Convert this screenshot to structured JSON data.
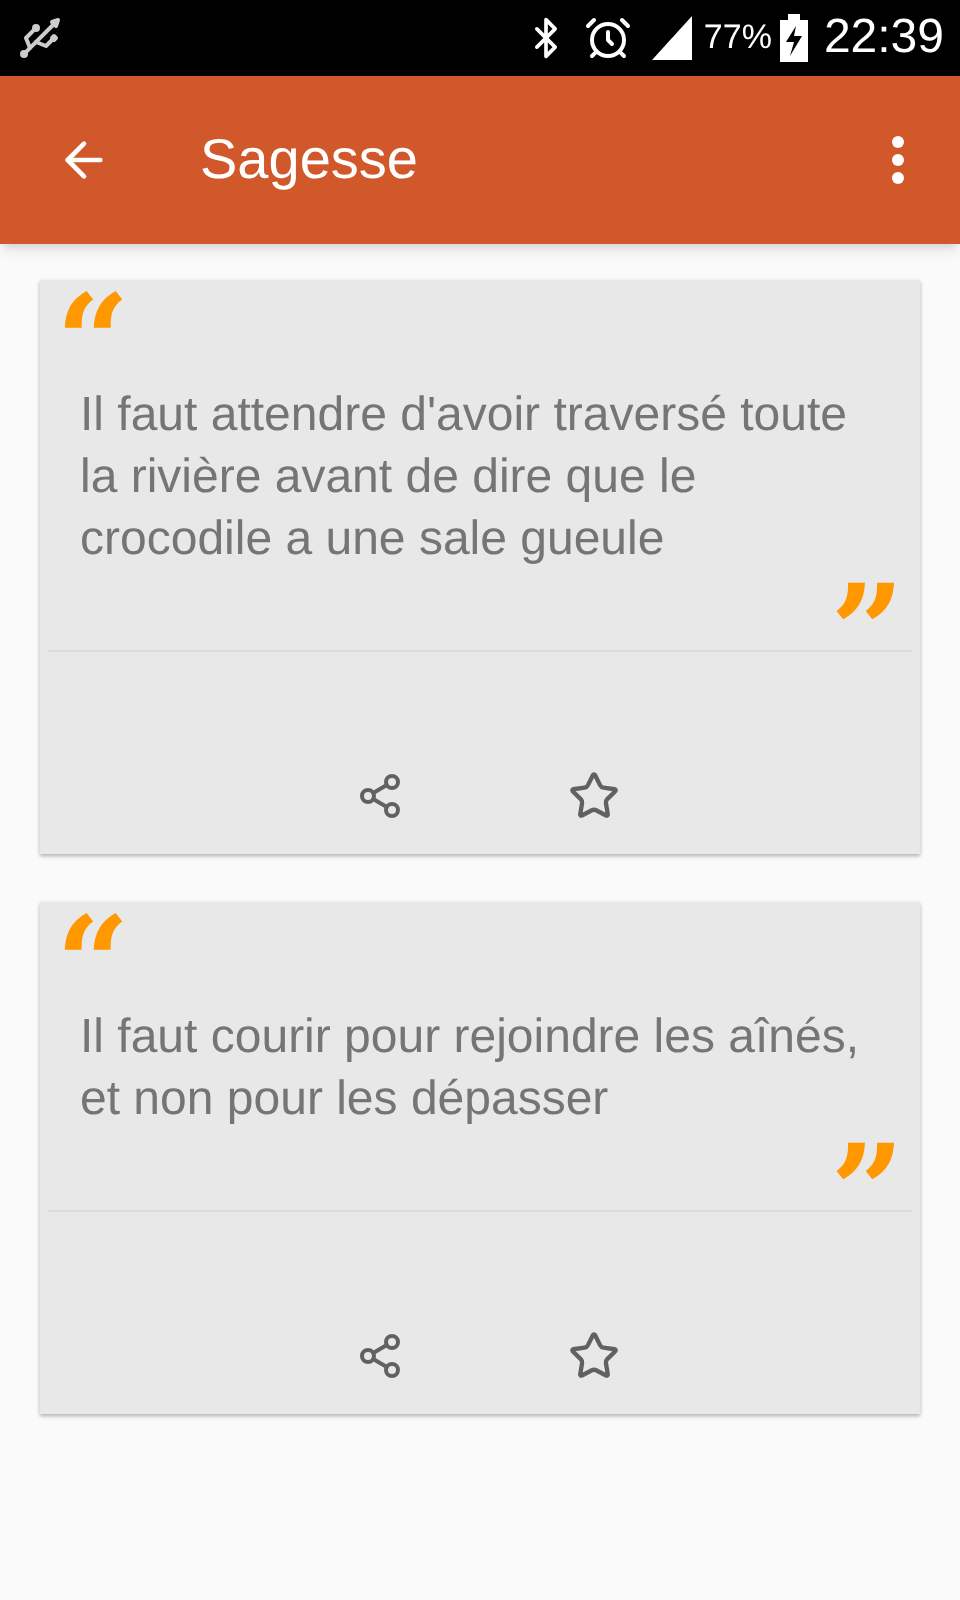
{
  "status_bar": {
    "battery": "77%",
    "time": "22:39"
  },
  "app_bar": {
    "title": "Sagesse"
  },
  "quotes": [
    {
      "open_mark": "“",
      "text": "Il faut attendre d'avoir traversé toute la rivière avant de dire que le crocodile a une sale gueule",
      "close_mark": "”",
      "favorite": false
    },
    {
      "open_mark": "“",
      "text": "Il faut courir pour rejoindre les aînés, et non pour les dépasser",
      "close_mark": "”",
      "favorite": false
    }
  ]
}
